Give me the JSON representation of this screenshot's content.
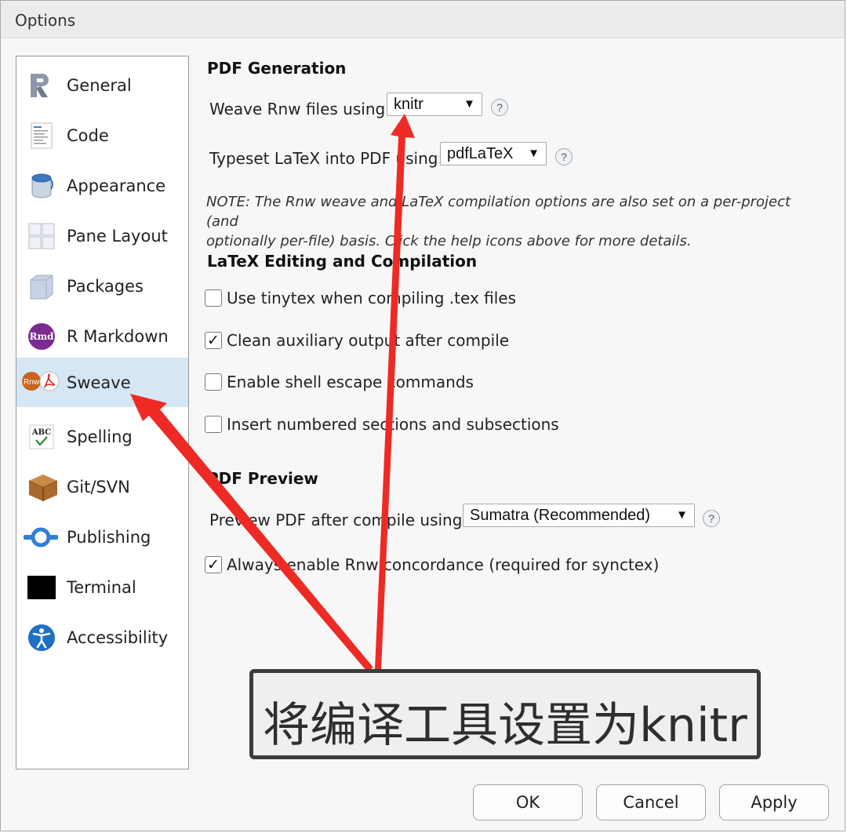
{
  "window": {
    "title": "Options"
  },
  "sidebar": {
    "items": [
      {
        "label": "General",
        "icon": "r-logo-icon"
      },
      {
        "label": "Code",
        "icon": "code-document-icon"
      },
      {
        "label": "Appearance",
        "icon": "paint-bucket-icon"
      },
      {
        "label": "Pane Layout",
        "icon": "pane-layout-icon"
      },
      {
        "label": "Packages",
        "icon": "package-box-icon"
      },
      {
        "label": "R Markdown",
        "icon": "rmd-icon"
      },
      {
        "label": "Sweave",
        "icon": "rnw-pdf-icon",
        "active": true
      },
      {
        "label": "Spelling",
        "icon": "spellcheck-icon"
      },
      {
        "label": "Git/SVN",
        "icon": "git-box-icon"
      },
      {
        "label": "Publishing",
        "icon": "publishing-icon"
      },
      {
        "label": "Terminal",
        "icon": "terminal-icon"
      },
      {
        "label": "Accessibility",
        "icon": "accessibility-icon"
      }
    ],
    "icon_texts": {
      "rmd": "Rmd",
      "rnw": "Rnw",
      "abc": "ABC"
    }
  },
  "pdf_generation": {
    "heading": "PDF Generation",
    "weave_label": "Weave Rnw files using:",
    "weave_value": "knitr",
    "typeset_label": "Typeset LaTeX into PDF using:",
    "typeset_value": "pdfLaTeX",
    "note_line1": "NOTE: The Rnw weave and LaTeX compilation options are also set on a per-project (and",
    "note_line2": "optionally per-file) basis. Click the help icons above for more details."
  },
  "latex_editing": {
    "heading": "LaTeX Editing and Compilation",
    "options": [
      {
        "label": "Use tinytex when compiling .tex files",
        "checked": false
      },
      {
        "label": "Clean auxiliary output after compile",
        "checked": true
      },
      {
        "label": "Enable shell escape commands",
        "checked": false
      },
      {
        "label": "Insert numbered sections and subsections",
        "checked": false
      }
    ]
  },
  "pdf_preview": {
    "heading": "PDF Preview",
    "preview_label": "Preview PDF after compile using:",
    "preview_value": "Sumatra (Recommended)",
    "concordance_label": "Always enable Rnw concordance (required for synctex)",
    "concordance_checked": true
  },
  "glyphs": {
    "dropdown": "▼",
    "help": "?",
    "check": "✓"
  },
  "buttons": {
    "ok": "OK",
    "cancel": "Cancel",
    "apply": "Apply"
  },
  "annotation": {
    "callout_text": "将编译工具设置为knitr",
    "arrow_color": "#ee2a24"
  }
}
